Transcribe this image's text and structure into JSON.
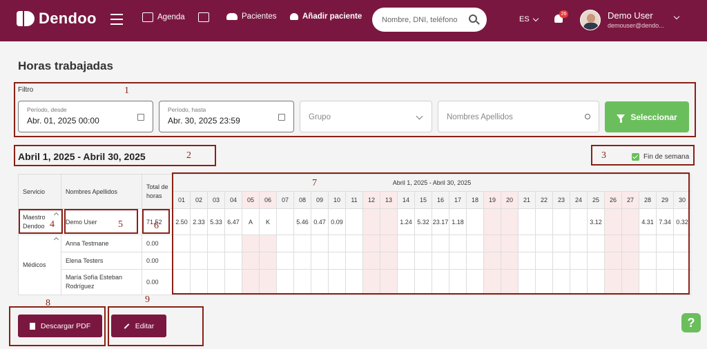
{
  "app": {
    "logo_text": "Dendoo",
    "nav": {
      "agenda": "Agenda",
      "pacientes": "Pacientes",
      "add_patient": "Añadir paciente"
    },
    "search_placeholder": "Nombre, DNI, teléfono",
    "lang": "ES",
    "notifications": "26",
    "user_name": "Demo User",
    "user_email": "demouser@dendo..."
  },
  "page": {
    "title": "Horas trabajadas",
    "filter_label": "Filtro",
    "from_label": "Período, desde",
    "from_value": "Abr. 01, 2025 00:00",
    "to_label": "Período, hasta",
    "to_value": "Abr. 30, 2025 23:59",
    "group_placeholder": "Grupo",
    "names_placeholder": "Nombres Apellidos",
    "select_button": "Seleccionar",
    "range_title": "Abril 1, 2025 - Abril 30, 2025",
    "weekend_label": "Fin de semana",
    "weekend_checked": true
  },
  "table": {
    "headers": {
      "service": "Servicio",
      "names": "Nombres Apellidos",
      "total": "Total de horas"
    },
    "grid_title": "Abril 1, 2025 - Abril 30, 2025",
    "days": [
      "01",
      "02",
      "03",
      "04",
      "05",
      "06",
      "07",
      "08",
      "09",
      "10",
      "11",
      "12",
      "13",
      "14",
      "15",
      "16",
      "17",
      "18",
      "19",
      "20",
      "21",
      "22",
      "23",
      "24",
      "25",
      "26",
      "27",
      "28",
      "29",
      "30"
    ],
    "weekend_days": [
      "05",
      "06",
      "12",
      "13",
      "19",
      "20",
      "26",
      "27"
    ],
    "rows": [
      {
        "service": "Maestro Dendoo",
        "name": "Demo User",
        "total": "71.52",
        "cells": [
          "2.50",
          "2.33",
          "5.33",
          "6.47",
          "A",
          "K",
          "",
          "5.46",
          "0.47",
          "0.09",
          "",
          "",
          "",
          "1.24",
          "5.32",
          "23.17",
          "1.18",
          "",
          "",
          "",
          "",
          "",
          "",
          "",
          "3.12",
          "",
          "",
          "4.31",
          "7.34",
          "0.32"
        ]
      },
      {
        "service": "Médicos",
        "name": "Anna Testmane",
        "total": "0.00",
        "cells": []
      },
      {
        "service": "",
        "name": "Elena Testers",
        "total": "0.00",
        "cells": []
      },
      {
        "service": "",
        "name": "María Sofía Esteban Rodríguez",
        "total": "0.00",
        "cells": []
      }
    ]
  },
  "actions": {
    "pdf": "Descargar PDF",
    "edit": "Editar",
    "help": "?"
  },
  "annotations": [
    "1",
    "2",
    "3",
    "4",
    "5",
    "6",
    "7",
    "8",
    "9"
  ],
  "colors": {
    "brand": "#7a1740",
    "accent": "#6abf5c",
    "annotation": "#8a1f14",
    "weekend": "#fbeaea"
  }
}
